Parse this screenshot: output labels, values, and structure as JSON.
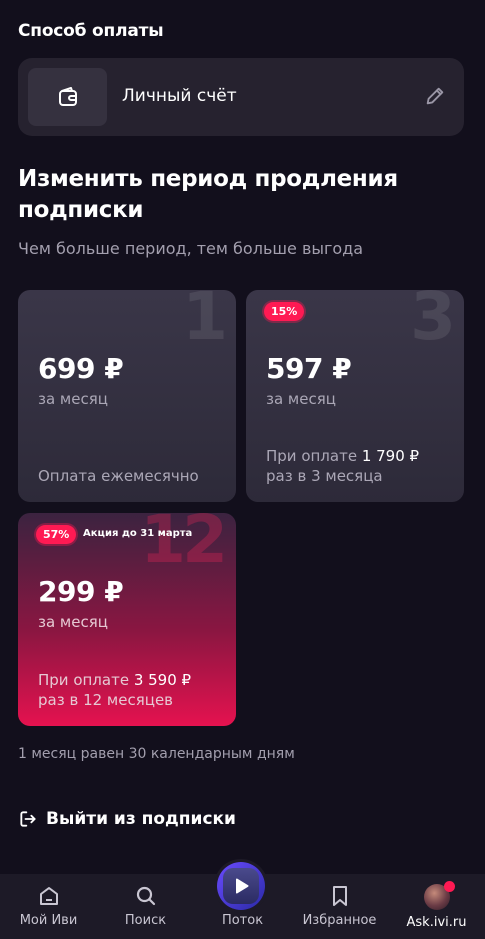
{
  "payment": {
    "section_title": "Способ оплаты",
    "method_label": "Личный счёт"
  },
  "renewal": {
    "heading": "Изменить период продления подписки",
    "subheading": "Чем больше период, тем больше выгода"
  },
  "plans": [
    {
      "period_number": "1",
      "price": "699 ₽",
      "per": "за месяц",
      "note": "Оплата ежемесячно"
    },
    {
      "period_number": "3",
      "discount": "15%",
      "price": "597 ₽",
      "per": "за месяц",
      "note_prefix": "При оплате ",
      "note_amount": "1 790 ₽",
      "note_suffix": "раз в 3 месяца"
    },
    {
      "period_number": "12",
      "discount": "57%",
      "promo": "Акция до 31 марта",
      "price": "299 ₽",
      "per": "за месяц",
      "note_prefix": "При оплате ",
      "note_amount": "3 590 ₽",
      "note_suffix": "раз в 12 месяцев"
    }
  ],
  "footnote": "1 месяц равен 30 календарным дням",
  "unsubscribe_label": "Выйти из подписки",
  "tabbar": {
    "tabs": [
      {
        "label": "Мой Иви",
        "icon": "home-icon"
      },
      {
        "label": "Поиск",
        "icon": "search-icon"
      },
      {
        "label": "Поток",
        "icon": "play-icon"
      },
      {
        "label": "Избранное",
        "icon": "bookmark-icon"
      },
      {
        "label": "Ask.ivi.ru",
        "icon": "avatar"
      }
    ]
  },
  "colors": {
    "background": "#120f1c",
    "card": "#26222f",
    "accent": "#ff1a53",
    "muted_text": "#a39fae"
  }
}
